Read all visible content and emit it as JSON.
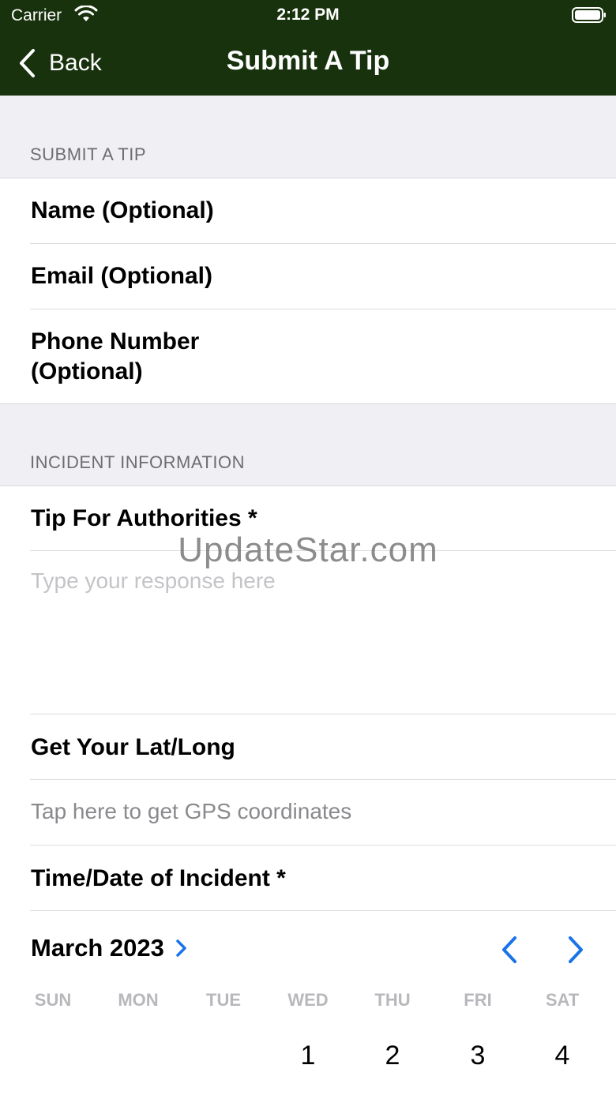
{
  "status_bar": {
    "carrier": "Carrier",
    "time": "2:12 PM"
  },
  "nav": {
    "back_label": "Back",
    "title": "Submit A Tip"
  },
  "colors": {
    "nav_background": "#17320c",
    "accent": "#1a73e8",
    "group_background": "#efeff4"
  },
  "sections": {
    "submit_tip": {
      "header": "SUBMIT A TIP",
      "name_label": "Name (Optional)",
      "email_label": "Email (Optional)",
      "phone_label_line1": "Phone Number",
      "phone_label_line2": "(Optional)"
    },
    "incident": {
      "header": "INCIDENT INFORMATION",
      "tip_label": "Tip For Authorities *",
      "tip_placeholder": "Type your response here",
      "latlong_label": "Get Your Lat/Long",
      "gps_action": "Tap here to get GPS coordinates",
      "time_label": "Time/Date of Incident *"
    }
  },
  "watermark": "UpdateStar.com",
  "calendar": {
    "month": "March 2023",
    "weekdays": [
      "SUN",
      "MON",
      "TUE",
      "WED",
      "THU",
      "FRI",
      "SAT"
    ],
    "first_week": [
      "",
      "",
      "",
      "1",
      "2",
      "3",
      "4"
    ]
  }
}
